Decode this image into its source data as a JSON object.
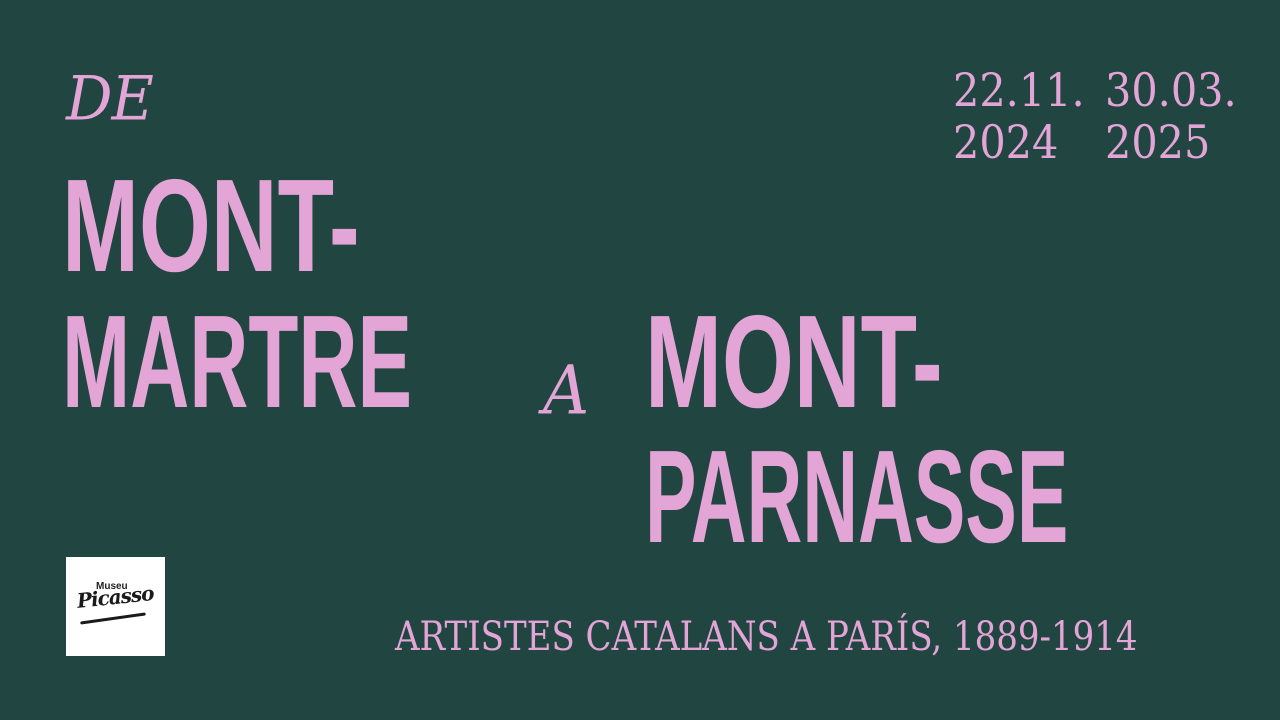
{
  "title": {
    "de": "DE",
    "line1": "MONT-",
    "line2": "MARTRE",
    "a": "A",
    "line3": "MONT-",
    "line4": "PARNASSE"
  },
  "dates": {
    "start_day": "22.11.",
    "start_year": "2024",
    "end_day": "30.03.",
    "end_year": "2025"
  },
  "subtitle": "ARTISTES CATALANS A PARÍS, 1889-1914",
  "logo": {
    "label": "Museu",
    "signature": "Picasso"
  },
  "colors": {
    "background": "#214541",
    "text": "#e3a4d6",
    "logo_bg": "#ffffff"
  }
}
